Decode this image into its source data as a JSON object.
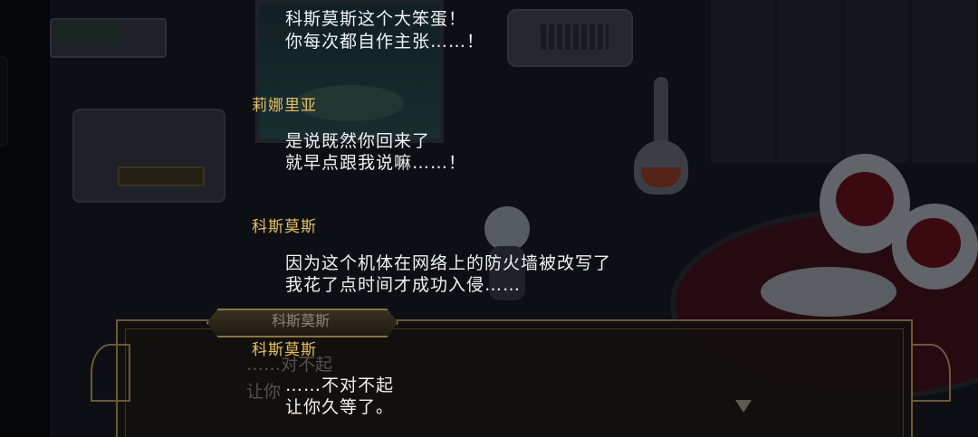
{
  "scene": {
    "background_name_plate": "科斯莫斯",
    "background_ghost_lines": [
      "……对不起",
      "让你"
    ]
  },
  "log": [
    {
      "speaker": "",
      "lines": [
        "科斯莫斯这个大笨蛋！",
        "你每次都自作主张……！"
      ]
    },
    {
      "speaker": "莉娜里亚",
      "lines": [
        "是说既然你回来了",
        "就早点跟我说嘛……！"
      ]
    },
    {
      "speaker": "科斯莫斯",
      "lines": [
        "因为这个机体在网络上的防火墙被改写了",
        "我花了点时间才成功入侵……"
      ]
    },
    {
      "speaker": "科斯莫斯",
      "lines": [
        "……不对不起",
        "让你久等了。"
      ]
    }
  ],
  "colors": {
    "speaker_name": "#e6c065",
    "dialogue_text": "#f2f2f2",
    "frame_gold": "#6b5a36"
  }
}
